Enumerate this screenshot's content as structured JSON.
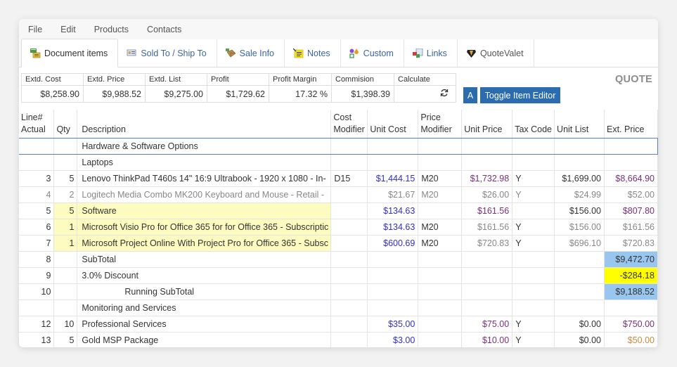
{
  "menu": [
    "File",
    "Edit",
    "Products",
    "Contacts"
  ],
  "tabs": [
    {
      "label": "Document items",
      "icon": "document-items-icon",
      "active": true
    },
    {
      "label": "Sold To / Ship To",
      "icon": "address-card-icon"
    },
    {
      "label": "Sale Info",
      "icon": "package-icon"
    },
    {
      "label": "Notes",
      "icon": "notes-icon"
    },
    {
      "label": "Custom",
      "icon": "custom-shapes-icon"
    },
    {
      "label": "Links",
      "icon": "links-icon"
    },
    {
      "label": "QuoteValet",
      "icon": "quotevalet-icon"
    }
  ],
  "summary": {
    "headers": [
      "Extd. Cost",
      "Extd. Price",
      "Extd. List",
      "Profit",
      "Profit Margin",
      "Commision",
      "Calculate"
    ],
    "values": [
      "$8,258.90",
      "$9,988.52",
      "$9,275.00",
      "$1,729.62",
      "17.32 %",
      "$1,398.39",
      ""
    ],
    "calculate_icon": "refresh-icon"
  },
  "buttons": {
    "a_label": "A",
    "toggle_label": "Toggle Item Editor"
  },
  "document_type": "QUOTE",
  "table": {
    "headers": {
      "line": [
        "Line#",
        "Actual"
      ],
      "qty": "Qty",
      "description": "Description",
      "cost_modifier": [
        "Cost",
        "Modifier"
      ],
      "unit_cost": "Unit Cost",
      "price_modifier": [
        "Price",
        "Modifier"
      ],
      "unit_price": "Unit Price",
      "tax_code": "Tax Code",
      "unit_list": "Unit List",
      "ext_price": "Ext. Price"
    },
    "rows": [
      {
        "line": "",
        "qty": "",
        "description": "Hardware & Software Options",
        "cost_modifier": "",
        "unit_cost": "",
        "price_modifier": "",
        "unit_price": "",
        "tax_code": "",
        "unit_list": "",
        "ext_price": ""
      },
      {
        "line": "",
        "qty": "",
        "description": "Laptops",
        "cost_modifier": "",
        "unit_cost": "",
        "price_modifier": "",
        "unit_price": "",
        "tax_code": "",
        "unit_list": "",
        "ext_price": ""
      },
      {
        "line": "3",
        "qty": "5",
        "description": "Lenovo ThinkPad T460s 14\" 16:9 Ultrabook - 1920 x 1080 - In-",
        "cost_modifier": "D15",
        "unit_cost": "$1,444.15",
        "price_modifier": "M20",
        "unit_price": "$1,732.98",
        "tax_code": "Y",
        "unit_list": "$1,699.00",
        "ext_price": "$8,664.90"
      },
      {
        "line": "4",
        "qty": "2",
        "description": "Logitech Media Combo MK200 Keyboard and Mouse - Retail -",
        "cost_modifier": "",
        "unit_cost": "$21.67",
        "price_modifier": "M20",
        "unit_price": "$26.00",
        "tax_code": "Y",
        "unit_list": "$24.99",
        "ext_price": "$52.00"
      },
      {
        "line": "5",
        "qty": "5",
        "description": "Software",
        "cost_modifier": "",
        "unit_cost": "$134.63",
        "price_modifier": "",
        "unit_price": "$161.56",
        "tax_code": "",
        "unit_list": "$156.00",
        "ext_price": "$807.80"
      },
      {
        "line": "6",
        "qty": "1",
        "description": "Microsoft Visio Pro for Office 365 for for Office 365 - Subscriptic",
        "cost_modifier": "",
        "unit_cost": "$134.63",
        "price_modifier": "M20",
        "unit_price": "$161.56",
        "tax_code": "Y",
        "unit_list": "$156.00",
        "ext_price": "$161.56"
      },
      {
        "line": "7",
        "qty": "1",
        "description": "Microsoft Project Online With Project Pro for Office 365 - Subsc",
        "cost_modifier": "",
        "unit_cost": "$600.69",
        "price_modifier": "M20",
        "unit_price": "$720.83",
        "tax_code": "Y",
        "unit_list": "$696.10",
        "ext_price": "$720.83"
      },
      {
        "line": "8",
        "qty": "",
        "description": "SubTotal",
        "cost_modifier": "",
        "unit_cost": "",
        "price_modifier": "",
        "unit_price": "",
        "tax_code": "",
        "unit_list": "",
        "ext_price": "$9,472.70"
      },
      {
        "line": "9",
        "qty": "",
        "description": "3.0% Discount",
        "cost_modifier": "",
        "unit_cost": "",
        "price_modifier": "",
        "unit_price": "",
        "tax_code": "",
        "unit_list": "",
        "ext_price": "-$284.18"
      },
      {
        "line": "10",
        "qty": "",
        "description": "Running SubTotal",
        "cost_modifier": "",
        "unit_cost": "",
        "price_modifier": "",
        "unit_price": "",
        "tax_code": "",
        "unit_list": "",
        "ext_price": "$9,188.52"
      },
      {
        "line": "",
        "qty": "",
        "description": "Monitoring and Services",
        "cost_modifier": "",
        "unit_cost": "",
        "price_modifier": "",
        "unit_price": "",
        "tax_code": "",
        "unit_list": "",
        "ext_price": ""
      },
      {
        "line": "12",
        "qty": "10",
        "description": "Professional Services",
        "cost_modifier": "",
        "unit_cost": "$35.00",
        "price_modifier": "",
        "unit_price": "$75.00",
        "tax_code": "Y",
        "unit_list": "$0.00",
        "ext_price": "$750.00"
      },
      {
        "line": "13",
        "qty": "5",
        "description": "Gold MSP Package",
        "cost_modifier": "",
        "unit_cost": "$3.00",
        "price_modifier": "",
        "unit_price": "$10.00",
        "tax_code": "Y",
        "unit_list": "$0.00",
        "ext_price": "$50.00"
      }
    ]
  },
  "colors": {
    "accent_button": "#2a6cae",
    "unit_cost_text": "#3030c8",
    "price_text": "#7a2f7a",
    "muted_text": "#888888",
    "subtotal_bg": "#98c6ee",
    "discount_bg": "#ffff00",
    "highlight_row_bg": "#fdfbc0",
    "tab_link": "#3a63a8"
  }
}
